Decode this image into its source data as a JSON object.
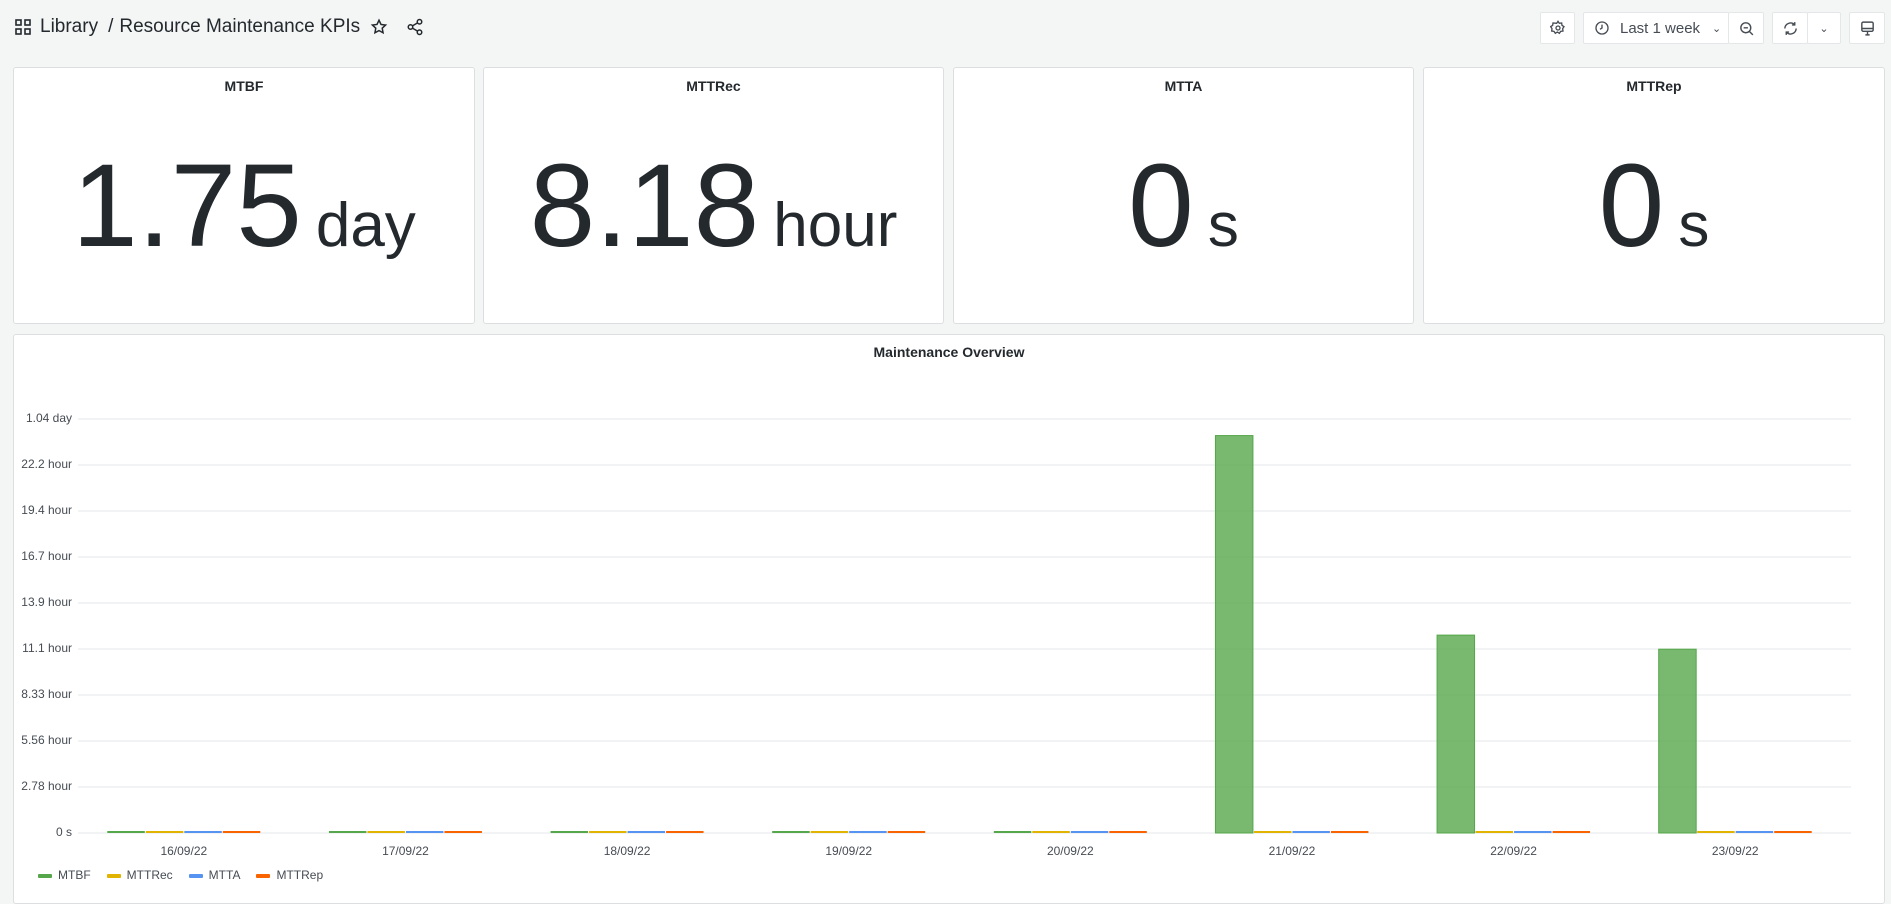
{
  "header": {
    "library": "Library",
    "separator": "/",
    "title": "Resource Maintenance KPIs",
    "time_range": "Last 1 week"
  },
  "stats": [
    {
      "title": "MTBF",
      "value": "1.75",
      "unit": "day"
    },
    {
      "title": "MTTRec",
      "value": "8.18",
      "unit": "hour"
    },
    {
      "title": "MTTA",
      "value": "0",
      "unit": "s"
    },
    {
      "title": "MTTRep",
      "value": "0",
      "unit": "s"
    }
  ],
  "chart_data": {
    "type": "bar",
    "title": "Maintenance Overview",
    "categories": [
      "16/09/22",
      "17/09/22",
      "18/09/22",
      "19/09/22",
      "20/09/22",
      "21/09/22",
      "22/09/22",
      "23/09/22"
    ],
    "yticks": [
      "0 s",
      "2.78 hour",
      "5.56 hour",
      "8.33 hour",
      "11.1 hour",
      "13.9 hour",
      "16.7 hour",
      "19.4 hour",
      "22.2 hour",
      "1.04 day"
    ],
    "ylim_hours": [
      0,
      25
    ],
    "ylabel": "",
    "xlabel": "",
    "legend_position": "bottom-left",
    "series": [
      {
        "name": "MTBF",
        "color": "#56a64b",
        "values_hours": [
          0,
          0,
          0,
          0,
          0,
          24,
          11.95,
          11.1
        ]
      },
      {
        "name": "MTTRec",
        "color": "#e0b400",
        "values_hours": [
          0,
          0,
          0,
          0,
          0,
          0,
          0,
          0
        ]
      },
      {
        "name": "MTTA",
        "color": "#5794f2",
        "values_hours": [
          0,
          0,
          0,
          0,
          0,
          0,
          0,
          0
        ]
      },
      {
        "name": "MTTRep",
        "color": "#fa6400",
        "values_hours": [
          0,
          0,
          0,
          0,
          0,
          0,
          0,
          0
        ]
      }
    ]
  }
}
